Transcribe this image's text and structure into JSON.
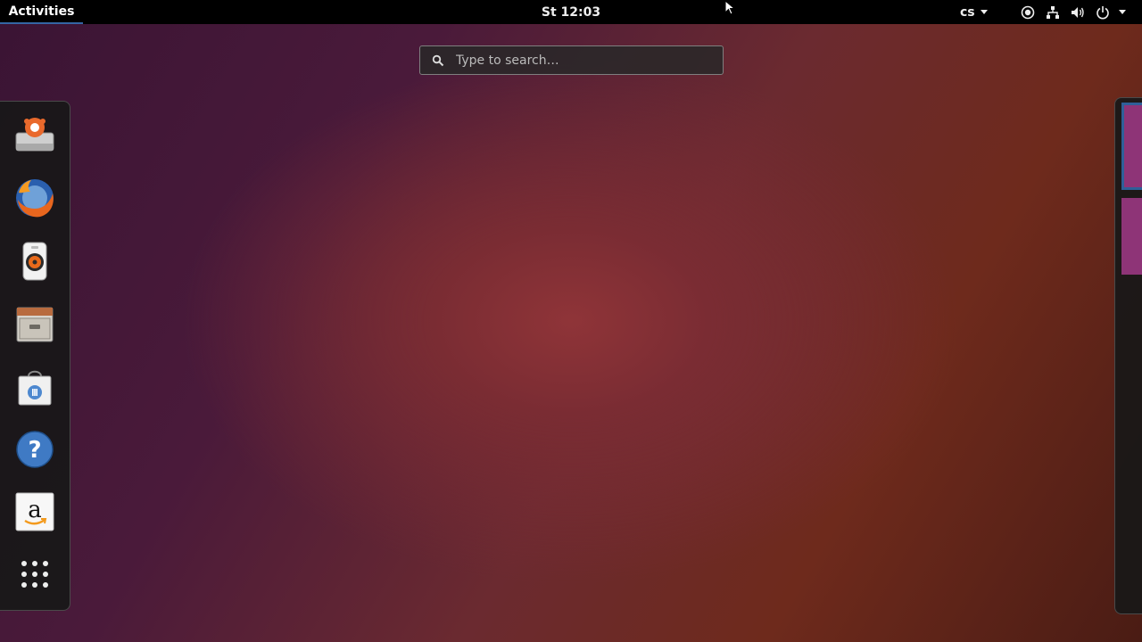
{
  "topbar": {
    "activities_label": "Activities",
    "clock": "St 12:03",
    "keyboard_layout": "cs"
  },
  "tray_icons": [
    "accessibility-icon",
    "network-icon",
    "volume-icon",
    "power-icon"
  ],
  "search": {
    "placeholder": "Type to search…",
    "value": ""
  },
  "dash": {
    "items": [
      {
        "name": "disk-installer-icon"
      },
      {
        "name": "firefox-icon"
      },
      {
        "name": "rhythmbox-icon"
      },
      {
        "name": "files-icon"
      },
      {
        "name": "software-center-icon"
      },
      {
        "name": "help-icon"
      },
      {
        "name": "amazon-icon"
      },
      {
        "name": "show-applications-icon"
      }
    ]
  },
  "workspaces": {
    "count": 2,
    "active_index": 0
  },
  "colors": {
    "topbar_bg": "#000000",
    "activities_underline": "#3465a4",
    "workspace_thumb": "#8e3477",
    "workspace_active_border": "#2f5f98"
  }
}
